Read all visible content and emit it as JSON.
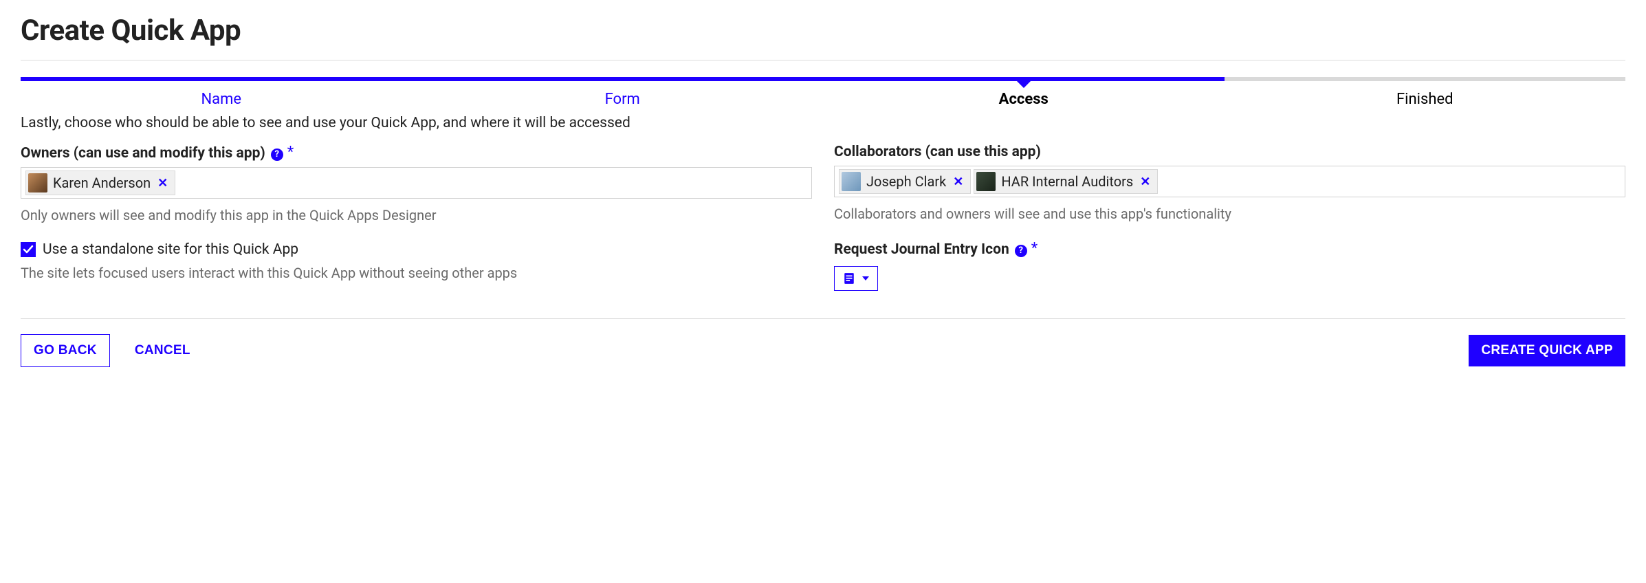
{
  "title": "Create Quick App",
  "wizard": {
    "steps": [
      "Name",
      "Form",
      "Access",
      "Finished"
    ],
    "active_index": 2
  },
  "instruction": "Lastly, choose who should be able to see and use your Quick App, and where it will be accessed",
  "owners": {
    "label": "Owners (can use and modify this app)",
    "tags": [
      {
        "name": "Karen Anderson"
      }
    ],
    "help": "Only owners will see and modify this app in the Quick Apps Designer"
  },
  "collaborators": {
    "label": "Collaborators (can use this app)",
    "tags": [
      {
        "name": "Joseph Clark"
      },
      {
        "name": "HAR Internal Auditors"
      }
    ],
    "help": "Collaborators and owners will see and use this app's functionality"
  },
  "standalone": {
    "checked": true,
    "label": "Use a standalone site for this Quick App",
    "help": "The site lets focused users interact with this Quick App without seeing other apps"
  },
  "icon_field": {
    "label": "Request Journal Entry Icon"
  },
  "buttons": {
    "back": "GO BACK",
    "cancel": "CANCEL",
    "create": "CREATE QUICK APP"
  }
}
